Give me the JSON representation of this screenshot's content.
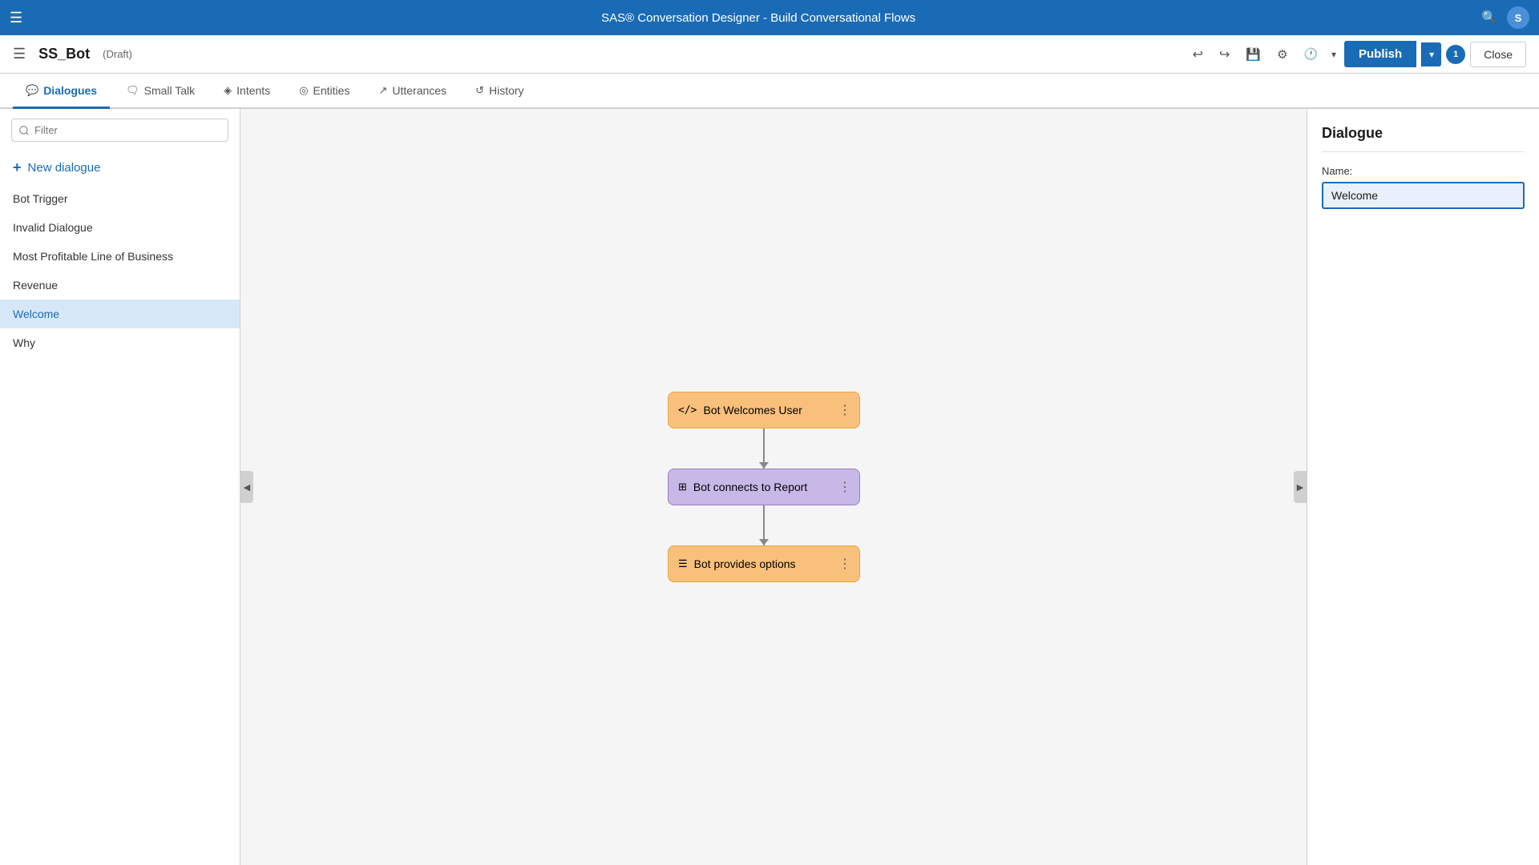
{
  "app": {
    "title": "SAS® Conversation Designer - Build Conversational Flows"
  },
  "topbar": {
    "hamburger": "☰",
    "title": "SAS® Conversation Designer - Build Conversational Flows",
    "avatar_label": "S"
  },
  "secondbar": {
    "bot_name": "SS_Bot",
    "draft_label": "(Draft)",
    "publish_label": "Publish",
    "close_label": "Close",
    "notif_count": "1"
  },
  "tabs": [
    {
      "id": "dialogues",
      "label": "Dialogues",
      "icon": "💬",
      "active": true
    },
    {
      "id": "small-talk",
      "label": "Small Talk",
      "icon": "🗨",
      "active": false
    },
    {
      "id": "intents",
      "label": "Intents",
      "icon": "◈",
      "active": false
    },
    {
      "id": "entities",
      "label": "Entities",
      "icon": "◎",
      "active": false
    },
    {
      "id": "utterances",
      "label": "Utterances",
      "icon": "↗",
      "active": false
    },
    {
      "id": "history",
      "label": "History",
      "icon": "↺",
      "active": false
    }
  ],
  "sidebar": {
    "filter_placeholder": "Filter",
    "new_dialogue_label": "New dialogue",
    "dialogues": [
      {
        "id": "bot-trigger",
        "label": "Bot Trigger",
        "active": false
      },
      {
        "id": "invalid-dialogue",
        "label": "Invalid Dialogue",
        "active": false
      },
      {
        "id": "most-profitable",
        "label": "Most Profitable Line of Business",
        "active": false
      },
      {
        "id": "revenue",
        "label": "Revenue",
        "active": false
      },
      {
        "id": "welcome",
        "label": "Welcome",
        "active": true
      },
      {
        "id": "why",
        "label": "Why",
        "active": false
      }
    ]
  },
  "canvas": {
    "nodes": [
      {
        "id": "node1",
        "label": "Bot Welcomes User",
        "icon": "</>",
        "type": "orange"
      },
      {
        "id": "node2",
        "label": "Bot connects to Report",
        "icon": "⊞",
        "type": "purple"
      },
      {
        "id": "node3",
        "label": "Bot provides options",
        "icon": "☰",
        "type": "orange"
      }
    ]
  },
  "right_panel": {
    "title": "Dialogue",
    "name_label": "Name:",
    "name_value": "Welcome"
  }
}
